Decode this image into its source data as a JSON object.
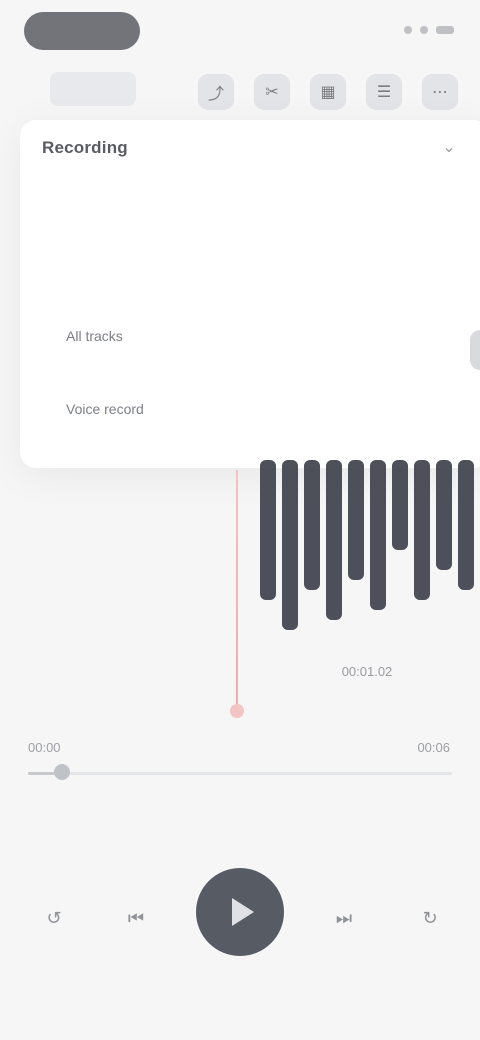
{
  "header": {
    "left_label": "",
    "toolbar_icons": [
      "share-icon",
      "scissors-icon",
      "grid-icon",
      "filter-icon",
      "more-icon"
    ]
  },
  "card": {
    "title": "Recording",
    "items": [
      {
        "label": "All tracks"
      },
      {
        "label": "Voice record"
      }
    ]
  },
  "waveform": {
    "label": "00:01.02",
    "accent": "#3b3d48"
  },
  "timeline": {
    "current_time": "00:00",
    "total_time": "00:06",
    "progress": 0.08
  },
  "controls": {
    "icons": [
      "rewind-icon",
      "skip-back-icon",
      "play-icon",
      "skip-forward-icon",
      "end-icon"
    ]
  },
  "colors": {
    "background": "#f6f6f7",
    "play_button": "#575b64",
    "playhead": "#f0aaaa"
  }
}
